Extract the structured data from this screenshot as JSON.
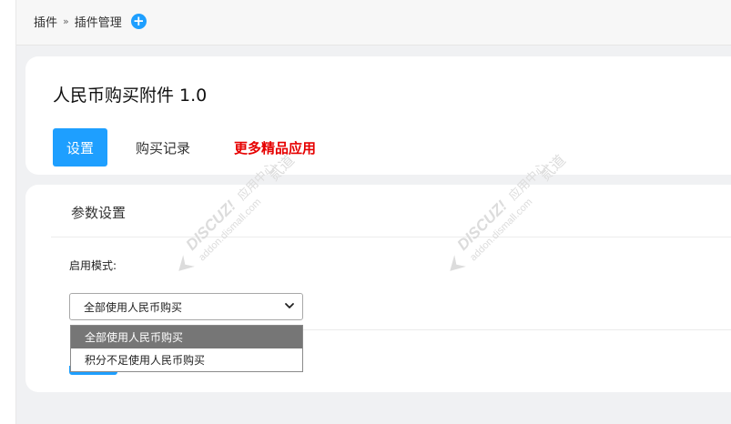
{
  "breadcrumb": {
    "root": "插件",
    "separator": "»",
    "current": "插件管理",
    "add_symbol": "+"
  },
  "plugin": {
    "title": "人民币购买附件 1.0"
  },
  "tabs": [
    {
      "label": "设置",
      "active": true
    },
    {
      "label": "购买记录",
      "active": false
    },
    {
      "label": "更多精品应用",
      "active": false,
      "color": "#e60000"
    }
  ],
  "settings": {
    "section_title": "参数设置",
    "mode_label": "启用模式:",
    "mode_select": {
      "selected": "全部使用人民币购买",
      "options": [
        "全部使用人民币购买",
        "积分不足使用人民币购买"
      ]
    }
  },
  "colors": {
    "accent": "#1e9fff",
    "highlight_text": "#e60000",
    "dropdown_selected_bg": "#767676"
  },
  "icons": {
    "add": "plus-circle-icon",
    "select_arrow": "chevron-down-icon",
    "watermark_logo": "discuz-arrow-logo"
  },
  "watermark": {
    "brand": "DISCUZ!",
    "line1_suffix": "应用中心",
    "line2": "addon.dismall.com",
    "trademark": "贰道"
  }
}
